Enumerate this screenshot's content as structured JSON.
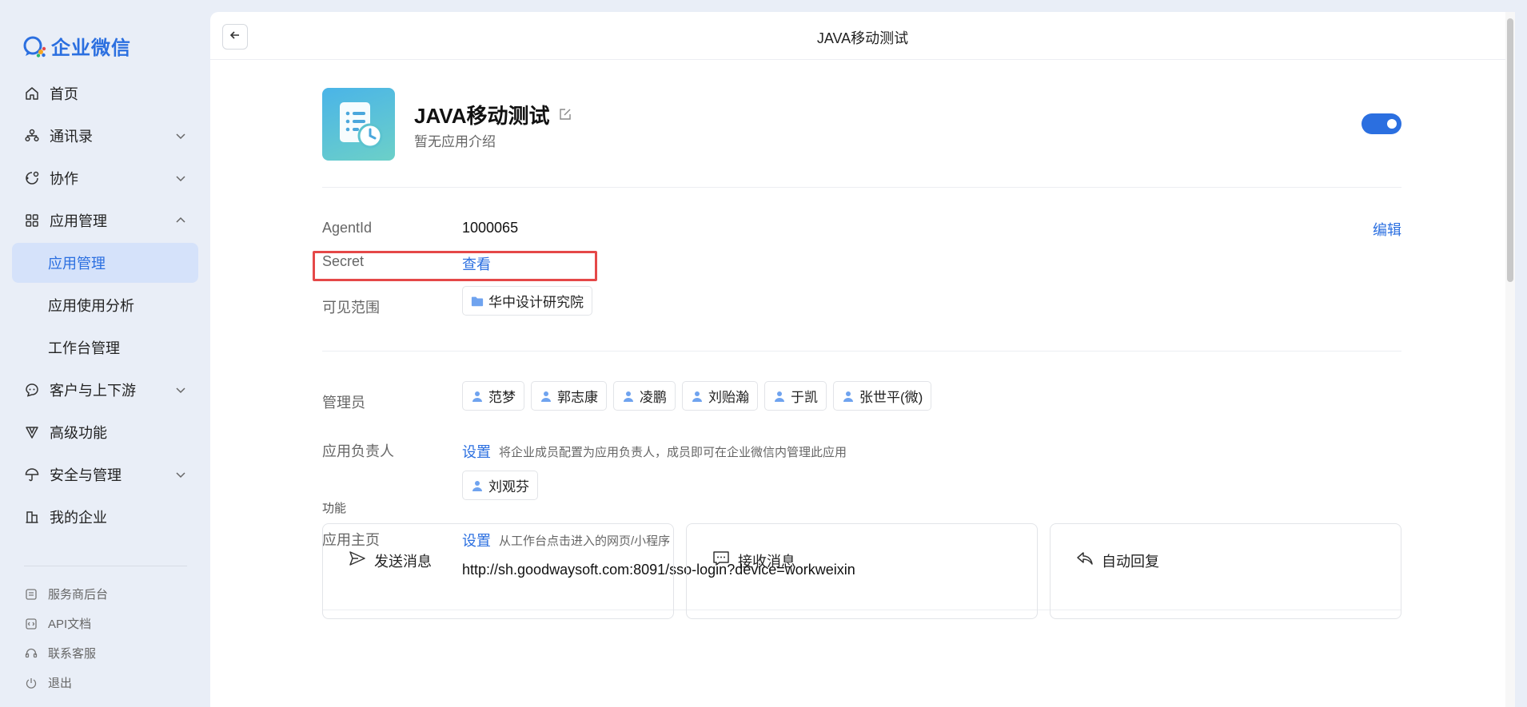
{
  "brand": {
    "name": "企业微信"
  },
  "sidebar": {
    "items": [
      {
        "label": "首页",
        "icon": "home-icon"
      },
      {
        "label": "通讯录",
        "icon": "contacts-icon",
        "expandable": true
      },
      {
        "label": "协作",
        "icon": "collab-icon",
        "expandable": true
      },
      {
        "label": "应用管理",
        "icon": "apps-icon",
        "expanded": true
      },
      {
        "label": "应用管理",
        "sub": true,
        "active": true
      },
      {
        "label": "应用使用分析",
        "sub": true
      },
      {
        "label": "工作台管理",
        "sub": true
      },
      {
        "label": "客户与上下游",
        "icon": "customer-icon",
        "expandable": true
      },
      {
        "label": "高级功能",
        "icon": "advanced-icon"
      },
      {
        "label": "安全与管理",
        "icon": "security-icon",
        "expandable": true
      },
      {
        "label": "我的企业",
        "icon": "company-icon"
      }
    ],
    "footer": [
      {
        "label": "服务商后台",
        "icon": "vendor-icon"
      },
      {
        "label": "API文档",
        "icon": "api-doc-icon"
      },
      {
        "label": "联系客服",
        "icon": "headset-icon"
      },
      {
        "label": "退出",
        "icon": "power-icon"
      }
    ]
  },
  "topbar": {
    "title": "JAVA移动测试"
  },
  "app": {
    "name": "JAVA移动测试",
    "description": "暂无应用介绍",
    "enabled": true
  },
  "info": {
    "agentid_label": "AgentId",
    "agentid_value": "1000065",
    "edit_label": "编辑",
    "secret_label": "Secret",
    "secret_action": "查看",
    "scope_label": "可见范围",
    "scope_value": "华中设计研究院"
  },
  "people": {
    "admins_label": "管理员",
    "admins": [
      "范梦",
      "郭志康",
      "凌鹏",
      "刘贻瀚",
      "于凯",
      "张世平(微)"
    ],
    "owner_label": "应用负责人",
    "owner_set": "设置",
    "owner_hint": "将企业成员配置为应用负责人，成员即可在企业微信内管理此应用",
    "owners": [
      "刘观芬"
    ],
    "home_label": "应用主页",
    "home_set": "设置",
    "home_hint": "从工作台点击进入的网页/小程序",
    "home_url": "http://sh.goodwaysoft.com:8091/sso-login?device=workweixin"
  },
  "functions": {
    "label": "功能",
    "cards": [
      {
        "title": "发送消息",
        "icon": "send-icon"
      },
      {
        "title": "接收消息",
        "icon": "message-icon"
      },
      {
        "title": "自动回复",
        "icon": "reply-icon"
      }
    ]
  },
  "colors": {
    "accent": "#2b6fe0",
    "highlight": "#e54848",
    "sidebar_bg": "#e9eef7"
  }
}
